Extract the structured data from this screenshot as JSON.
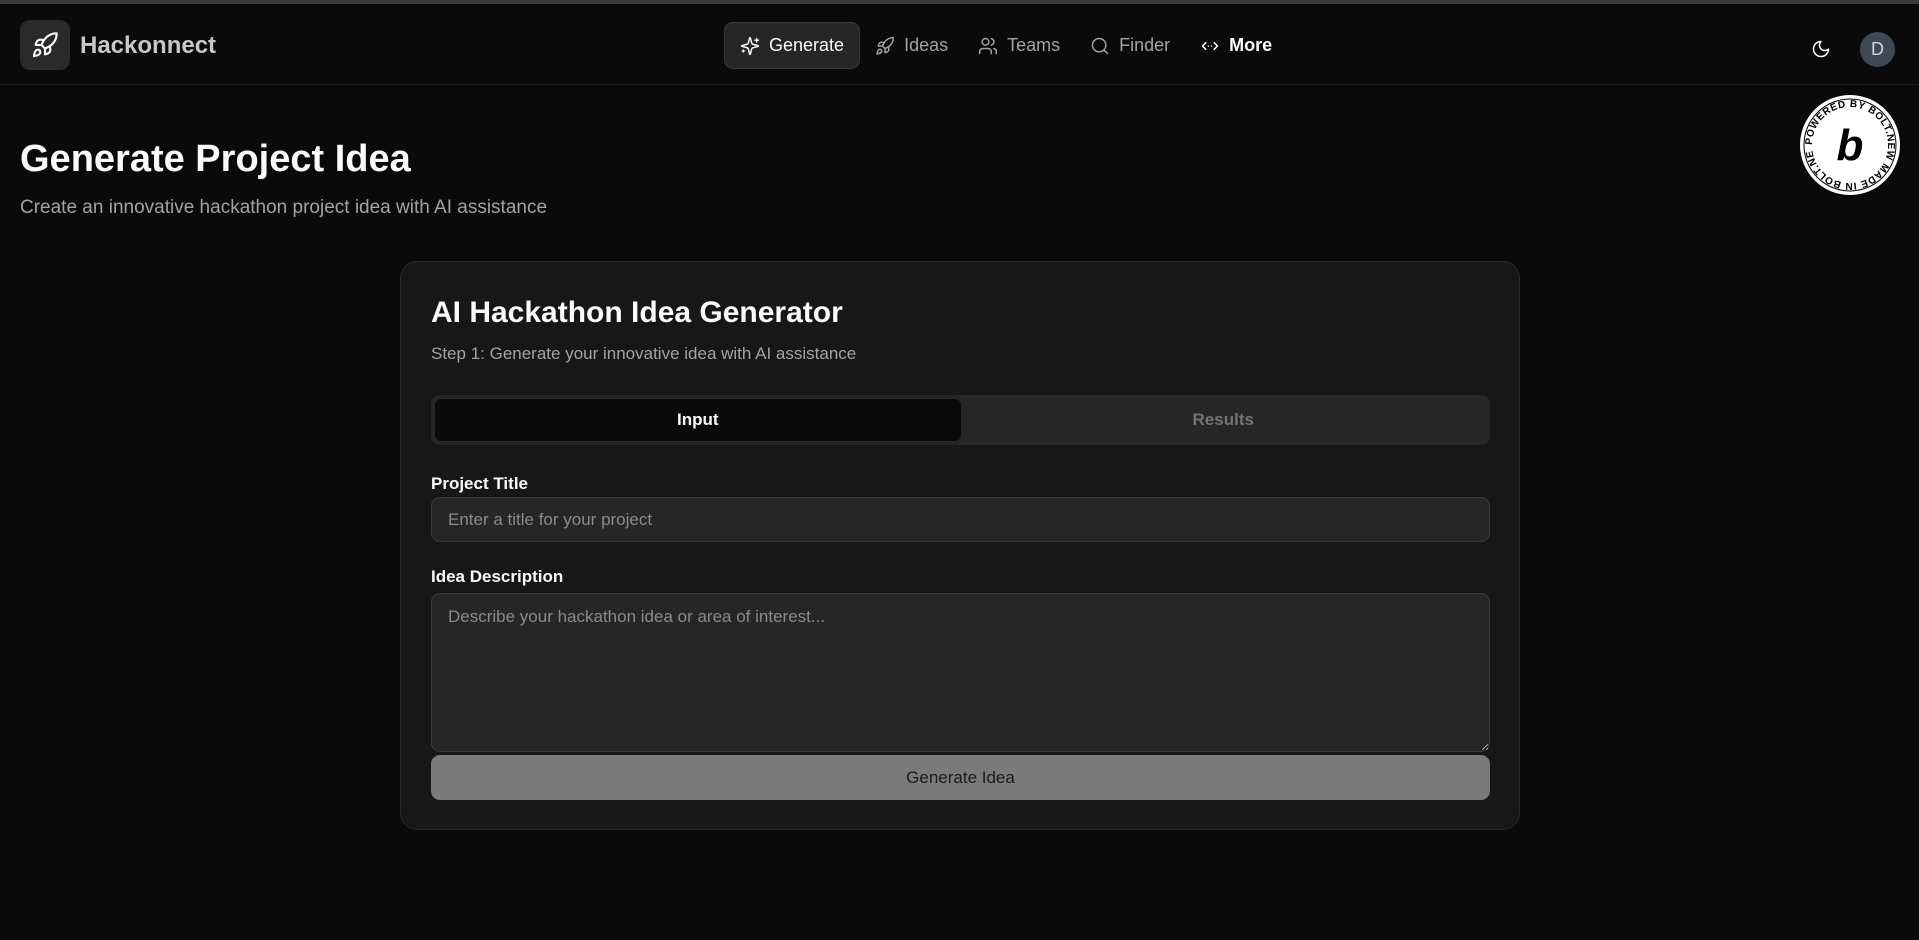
{
  "app": {
    "name": "Hackonnect",
    "logo_icon": "rocket-icon"
  },
  "nav": {
    "items": [
      {
        "label": "Generate",
        "icon": "sparkles-icon",
        "active": true
      },
      {
        "label": "Ideas",
        "icon": "rocket-icon"
      },
      {
        "label": "Teams",
        "icon": "users-icon"
      },
      {
        "label": "Finder",
        "icon": "search-icon"
      },
      {
        "label": "More",
        "icon": "code-icon"
      }
    ]
  },
  "header": {
    "theme_icon": "moon-icon",
    "avatar_initial": "D"
  },
  "badge": {
    "text": "POWERED BY BOLT.NEW MADE IN BOLT.NEW",
    "letter": "b"
  },
  "page": {
    "title": "Generate Project Idea",
    "subtitle": "Create an innovative hackathon project idea with AI assistance"
  },
  "card": {
    "title": "AI Hackathon Idea Generator",
    "subtitle": "Step 1: Generate your innovative idea with AI assistance",
    "tabs": [
      {
        "label": "Input",
        "active": true
      },
      {
        "label": "Results",
        "active": false
      }
    ],
    "project_title_label": "Project Title",
    "project_title_placeholder": "Enter a title for your project",
    "project_title_value": "",
    "description_label": "Idea Description",
    "description_placeholder": "Describe your hackathon idea or area of interest...",
    "description_value": "",
    "button_label": "Generate Idea"
  },
  "colors": {
    "background": "#0a0a0a",
    "card": "#171717",
    "input": "#262626",
    "button": "#7a7a7a"
  }
}
